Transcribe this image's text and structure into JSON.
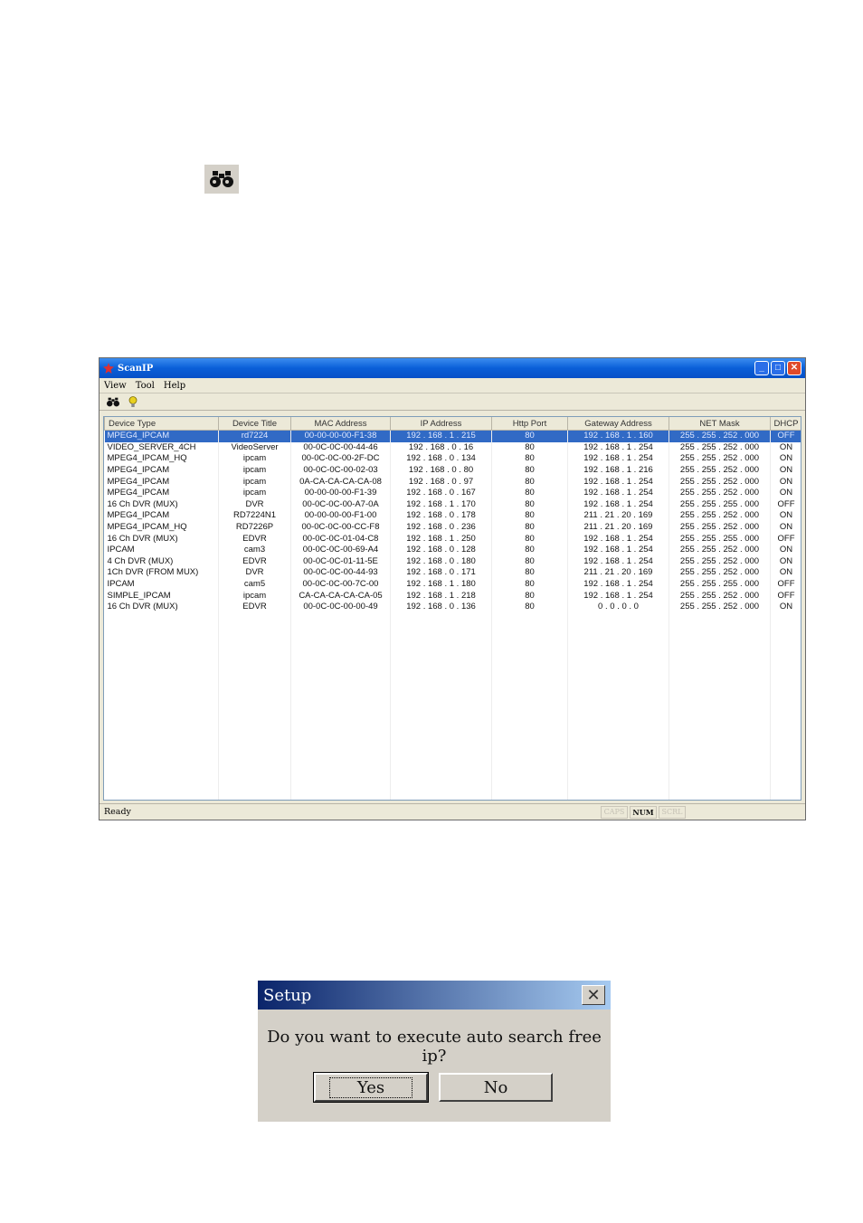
{
  "icons": {
    "search": "binoculars-icon",
    "help": "lightbulb-icon"
  },
  "window": {
    "title": "ScanIP",
    "menu": [
      "View",
      "Tool",
      "Help"
    ],
    "columns": [
      "Device Type",
      "Device Title",
      "MAC Address",
      "IP Address",
      "Http Port",
      "Gateway Address",
      "NET Mask",
      "DHCP"
    ],
    "rows": [
      [
        "MPEG4_IPCAM",
        "rd7224",
        "00-00-00-00-F1-38",
        "192 . 168 . 1 . 215",
        "80",
        "192 . 168 . 1 . 160",
        "255 . 255 . 252 . 000",
        "OFF"
      ],
      [
        "VIDEO_SERVER_4CH",
        "VideoServer",
        "00-0C-0C-00-44-46",
        "192 . 168 . 0 . 16",
        "80",
        "192 . 168 . 1 . 254",
        "255 . 255 . 252 . 000",
        "ON"
      ],
      [
        "MPEG4_IPCAM_HQ",
        "ipcam",
        "00-0C-0C-00-2F-DC",
        "192 . 168 . 0 . 134",
        "80",
        "192 . 168 . 1 . 254",
        "255 . 255 . 252 . 000",
        "ON"
      ],
      [
        "MPEG4_IPCAM",
        "ipcam",
        "00-0C-0C-00-02-03",
        "192 . 168 . 0 . 80",
        "80",
        "192 . 168 . 1 . 216",
        "255 . 255 . 252 . 000",
        "ON"
      ],
      [
        "MPEG4_IPCAM",
        "ipcam",
        "0A-CA-CA-CA-CA-08",
        "192 . 168 . 0 . 97",
        "80",
        "192 . 168 . 1 . 254",
        "255 . 255 . 252 . 000",
        "ON"
      ],
      [
        "MPEG4_IPCAM",
        "ipcam",
        "00-00-00-00-F1-39",
        "192 . 168 . 0 . 167",
        "80",
        "192 . 168 . 1 . 254",
        "255 . 255 . 252 . 000",
        "ON"
      ],
      [
        "16 Ch DVR (MUX)",
        "DVR",
        "00-0C-0C-00-A7-0A",
        "192 . 168 . 1 . 170",
        "80",
        "192 . 168 . 1 . 254",
        "255 . 255 . 255 . 000",
        "OFF"
      ],
      [
        "MPEG4_IPCAM",
        "RD7224N1",
        "00-00-00-00-F1-00",
        "192 . 168 . 0 . 178",
        "80",
        "211 . 21 . 20 . 169",
        "255 . 255 . 252 . 000",
        "ON"
      ],
      [
        "MPEG4_IPCAM_HQ",
        "RD7226P",
        "00-0C-0C-00-CC-F8",
        "192 . 168 . 0 . 236",
        "80",
        "211 . 21 . 20 . 169",
        "255 . 255 . 252 . 000",
        "ON"
      ],
      [
        "16 Ch DVR (MUX)",
        "EDVR",
        "00-0C-0C-01-04-C8",
        "192 . 168 . 1 . 250",
        "80",
        "192 . 168 . 1 . 254",
        "255 . 255 . 255 . 000",
        "OFF"
      ],
      [
        "IPCAM",
        "cam3",
        "00-0C-0C-00-69-A4",
        "192 . 168 . 0 . 128",
        "80",
        "192 . 168 . 1 . 254",
        "255 . 255 . 252 . 000",
        "ON"
      ],
      [
        "4 Ch DVR (MUX)",
        "EDVR",
        "00-0C-0C-01-11-5E",
        "192 . 168 . 0 . 180",
        "80",
        "192 . 168 . 1 . 254",
        "255 . 255 . 252 . 000",
        "ON"
      ],
      [
        "1Ch DVR (FROM MUX)",
        "DVR",
        "00-0C-0C-00-44-93",
        "192 . 168 . 0 . 171",
        "80",
        "211 . 21 . 20 . 169",
        "255 . 255 . 252 . 000",
        "ON"
      ],
      [
        "IPCAM",
        "cam5",
        "00-0C-0C-00-7C-00",
        "192 . 168 . 1 . 180",
        "80",
        "192 . 168 . 1 . 254",
        "255 . 255 . 255 . 000",
        "OFF"
      ],
      [
        "SIMPLE_IPCAM",
        "ipcam",
        "CA-CA-CA-CA-CA-05",
        "192 . 168 . 1 . 218",
        "80",
        "192 . 168 . 1 . 254",
        "255 . 255 . 252 . 000",
        "OFF"
      ],
      [
        "16 Ch DVR (MUX)",
        "EDVR",
        "00-0C-0C-00-00-49",
        "192 . 168 . 0 . 136",
        "80",
        "0 . 0 . 0 . 0",
        "255 . 255 . 252 . 000",
        "ON"
      ]
    ],
    "status": {
      "text": "Ready",
      "cap": "CAPS",
      "num": "NUM",
      "scrl": "SCRL"
    }
  },
  "dialog": {
    "title": "Setup",
    "message": "Do you want to execute auto search free ip?",
    "yes_label": "Yes",
    "no_label": "No"
  }
}
